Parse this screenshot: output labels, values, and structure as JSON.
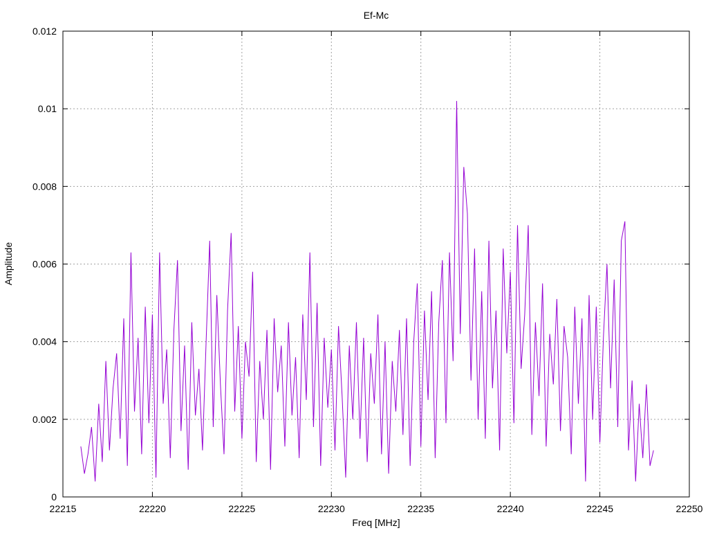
{
  "chart_data": {
    "type": "line",
    "title": "Ef-Mc",
    "xlabel": "Freq [MHz]",
    "ylabel": "Amplitude",
    "xlim": [
      22215,
      22250
    ],
    "ylim": [
      0,
      0.012
    ],
    "xticks": [
      "22215",
      "22220",
      "22225",
      "22230",
      "22235",
      "22240",
      "22245",
      "22250"
    ],
    "xtick_values": [
      22215,
      22220,
      22225,
      22230,
      22235,
      22240,
      22245,
      22250
    ],
    "yticks": [
      "0",
      "0.002",
      "0.004",
      "0.006",
      "0.008",
      "0.01",
      "0.012"
    ],
    "ytick_values": [
      0,
      0.002,
      0.004,
      0.006,
      0.008,
      0.01,
      0.012
    ],
    "grid": true,
    "series": [
      {
        "name": "Ef-Mc",
        "color": "#9400d3",
        "x_start": 22216,
        "x_step": 0.2,
        "values": [
          0.0013,
          0.0006,
          0.0011,
          0.0018,
          0.0004,
          0.0024,
          0.0009,
          0.0035,
          0.0012,
          0.0028,
          0.0037,
          0.0015,
          0.0046,
          0.0008,
          0.0063,
          0.0022,
          0.0041,
          0.0011,
          0.0049,
          0.0019,
          0.0047,
          0.0005,
          0.0063,
          0.0024,
          0.0038,
          0.001,
          0.0043,
          0.0061,
          0.0017,
          0.0039,
          0.0007,
          0.0045,
          0.0021,
          0.0033,
          0.0012,
          0.004,
          0.0066,
          0.0018,
          0.0052,
          0.0029,
          0.0011,
          0.0048,
          0.0068,
          0.0022,
          0.0044,
          0.0015,
          0.004,
          0.0031,
          0.0058,
          0.0009,
          0.0035,
          0.002,
          0.0043,
          0.0007,
          0.0046,
          0.0027,
          0.0039,
          0.0013,
          0.0045,
          0.0021,
          0.0036,
          0.001,
          0.0047,
          0.0025,
          0.0063,
          0.0018,
          0.005,
          0.0008,
          0.0041,
          0.0023,
          0.0038,
          0.0012,
          0.0044,
          0.0026,
          0.0005,
          0.0039,
          0.002,
          0.0045,
          0.0015,
          0.0041,
          0.0009,
          0.0037,
          0.0024,
          0.0047,
          0.0011,
          0.004,
          0.0006,
          0.0035,
          0.0022,
          0.0043,
          0.0016,
          0.0046,
          0.0008,
          0.004,
          0.0055,
          0.0013,
          0.0048,
          0.0025,
          0.0053,
          0.001,
          0.0045,
          0.0061,
          0.0019,
          0.0063,
          0.0035,
          0.0102,
          0.0042,
          0.0085,
          0.0073,
          0.003,
          0.0064,
          0.002,
          0.0053,
          0.0015,
          0.0066,
          0.0028,
          0.0048,
          0.0012,
          0.0064,
          0.0037,
          0.0058,
          0.0019,
          0.007,
          0.0033,
          0.0047,
          0.007,
          0.0016,
          0.0045,
          0.0026,
          0.0055,
          0.0013,
          0.0042,
          0.0029,
          0.0051,
          0.0017,
          0.0044,
          0.0036,
          0.0011,
          0.0049,
          0.0024,
          0.0046,
          0.0004,
          0.0052,
          0.002,
          0.0049,
          0.0014,
          0.0041,
          0.006,
          0.0028,
          0.0056,
          0.0018,
          0.0066,
          0.0071,
          0.0012,
          0.003,
          0.0004,
          0.0024,
          0.001,
          0.0029,
          0.0008,
          0.0012
        ]
      }
    ]
  }
}
